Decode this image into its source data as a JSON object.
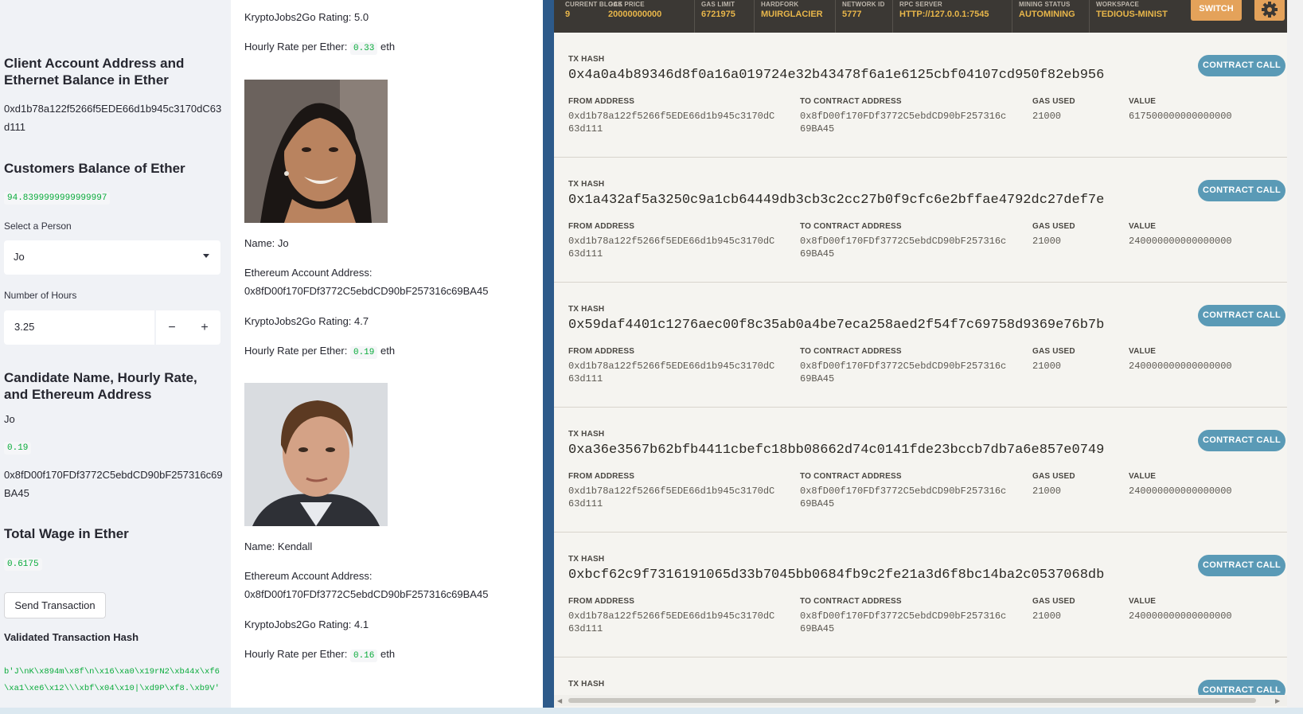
{
  "sidebar": {
    "client_heading": "Client Account Address and Ethernet Balance in Ether",
    "client_address": "0xd1b78a122f5266f5EDE66d1b945c3170dC63d111",
    "balance_heading": "Customers Balance of Ether",
    "balance_value": "94.8399999999999997",
    "select_label": "Select a Person",
    "select_value": "Jo",
    "hours_label": "Number of Hours",
    "hours_value": "3.25",
    "minus": "−",
    "plus": "+",
    "candidate_heading": "Candidate Name, Hourly Rate, and Ethereum Address",
    "candidate_name": "Jo",
    "candidate_rate": "0.19",
    "candidate_address": "0x8fD00f170FDf3772C5ebdCD90bF257316c69BA45",
    "wage_heading": "Total Wage in Ether",
    "wage_value": "0.6175",
    "send_button": "Send Transaction",
    "validated_heading": "Validated Transaction Hash",
    "validated_hash": "b'J\\nK\\x894m\\x8f\\n\\x16\\xa0\\x19rN2\\xb44x\\xf6\\xa1\\xe6\\x12\\\\\\xbf\\x04\\x10|\\xd9P\\xf8.\\xb9V'"
  },
  "middle": {
    "top_rating": "KryptoJobs2Go Rating: 5.0",
    "top_rate_label": "Hourly Rate per Ether:",
    "top_rate_value": "0.33",
    "top_rate_unit": "eth",
    "candidates": [
      {
        "name": "Name: Jo",
        "address_label": "Ethereum Account Address:",
        "address": "0x8fD00f170FDf3772C5ebdCD90bF257316c69BA45",
        "rating": "KryptoJobs2Go Rating: 4.7",
        "rate_label": "Hourly Rate per Ether:",
        "rate_value": "0.19",
        "rate_unit": "eth"
      },
      {
        "name": "Name: Kendall",
        "address_label": "Ethereum Account Address:",
        "address": "0x8fD00f170FDf3772C5ebdCD90bF257316c69BA45",
        "rating": "KryptoJobs2Go Rating: 4.1",
        "rate_label": "Hourly Rate per Ether:",
        "rate_value": "0.16",
        "rate_unit": "eth"
      }
    ]
  },
  "ganache": {
    "stats": [
      {
        "label": "CURRENT BLOCK",
        "value": "9"
      },
      {
        "label": "GAS PRICE",
        "value": "20000000000"
      },
      {
        "label": "GAS LIMIT",
        "value": "6721975"
      },
      {
        "label": "HARDFORK",
        "value": "MUIRGLACIER"
      },
      {
        "label": "NETWORK ID",
        "value": "5777"
      },
      {
        "label": "RPC SERVER",
        "value": "HTTP://127.0.0.1:7545"
      },
      {
        "label": "MINING STATUS",
        "value": "AUTOMINING"
      },
      {
        "label": "WORKSPACE",
        "value": "TEDIOUS-MINIST"
      }
    ],
    "switch_label": "SWITCH",
    "labels": {
      "tx_hash": "TX HASH",
      "from": "FROM ADDRESS",
      "to": "TO CONTRACT ADDRESS",
      "gas": "GAS USED",
      "value": "VALUE",
      "contract_call": "CONTRACT CALL"
    },
    "transactions": [
      {
        "hash": "0x4a0a4b89346d8f0a16a019724e32b43478f6a1e6125cbf04107cd950f82eb956",
        "from1": "0xd1b78a122f5266f5EDE66d1b945c3170dC",
        "from2": "63d111",
        "to1": "0x8fD00f170FDf3772C5ebdCD90bF257316c",
        "to2": "69BA45",
        "gas": "21000",
        "value": "617500000000000000"
      },
      {
        "hash": "0x1a432af5a3250c9a1cb64449db3cb3c2cc27b0f9cfc6e2bffae4792dc27def7e",
        "from1": "0xd1b78a122f5266f5EDE66d1b945c3170dC",
        "from2": "63d111",
        "to1": "0x8fD00f170FDf3772C5ebdCD90bF257316c",
        "to2": "69BA45",
        "gas": "21000",
        "value": "240000000000000000"
      },
      {
        "hash": "0x59daf4401c1276aec00f8c35ab0a4be7eca258aed2f54f7c69758d9369e76b7b",
        "from1": "0xd1b78a122f5266f5EDE66d1b945c3170dC",
        "from2": "63d111",
        "to1": "0x8fD00f170FDf3772C5ebdCD90bF257316c",
        "to2": "69BA45",
        "gas": "21000",
        "value": "240000000000000000"
      },
      {
        "hash": "0xa36e3567b62bfb4411cbefc18bb08662d74c0141fde23bccb7db7a6e857e0749",
        "from1": "0xd1b78a122f5266f5EDE66d1b945c3170dC",
        "from2": "63d111",
        "to1": "0x8fD00f170FDf3772C5ebdCD90bF257316c",
        "to2": "69BA45",
        "gas": "21000",
        "value": "240000000000000000"
      },
      {
        "hash": "0xbcf62c9f7316191065d33b7045bb0684fb9c2fe21a3d6f8bc14ba2c0537068db",
        "from1": "0xd1b78a122f5266f5EDE66d1b945c3170dC",
        "from2": "63d111",
        "to1": "0x8fD00f170FDf3772C5ebdCD90bF257316c",
        "to2": "69BA45",
        "gas": "21000",
        "value": "240000000000000000"
      }
    ]
  }
}
